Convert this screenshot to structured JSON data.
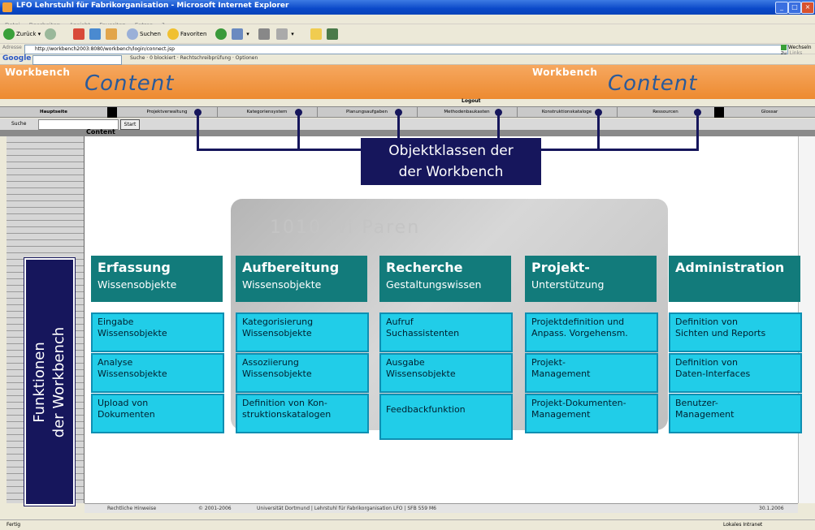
{
  "browser": {
    "title": "LFO Lehrstuhl für Fabrikorganisation - Microsoft Internet Explorer",
    "menu": [
      "Datei",
      "Bearbeiten",
      "Ansicht",
      "Favoriten",
      "Extras",
      "?"
    ],
    "toolbar": {
      "back": "Zurück",
      "search": "Suchen",
      "favorites": "Favoriten"
    },
    "address_label": "Adresse",
    "address_value": "http://workbench2003:8080/workbench/login/connect.jsp",
    "go_label": "Wechseln zu",
    "links_label": "Links",
    "google": {
      "brand": "Google",
      "items": "Suche  ·  0 blockiert  ·  Rechtschreibprüfung  ·  Optionen"
    }
  },
  "site": {
    "brand_left": "Workbench",
    "content_left": "Content",
    "brand_right": "Workbench",
    "content_right": "Content",
    "logout": "Logout",
    "nav": [
      "Hauptseite",
      "Projektverwaltung",
      "Kategoriensystem",
      "Planungsaufgaben",
      "Methodenbaukasten",
      "Konstruktionskataloge",
      "Ressourcen",
      "Glossar"
    ],
    "search_label": "Suche",
    "start_button": "Start",
    "content_label": "Content"
  },
  "overlay": {
    "objektklassen_line1": "Objektklassen der",
    "objektklassen_line2": "der Workbench",
    "funktionen_line1": "Funktionen",
    "funktionen_line2": "der Workbench",
    "watermark": "1010 Wi Paren"
  },
  "columns": [
    {
      "title": "Erfassung",
      "subtitle": "Wissensobjekte",
      "items": [
        [
          "Eingabe",
          "Wissensobjekte"
        ],
        [
          "Analyse",
          "Wissensobjekte"
        ],
        [
          "Upload von",
          "Dokumenten"
        ]
      ]
    },
    {
      "title": "Aufbereitung",
      "subtitle": "Wissensobjekte",
      "items": [
        [
          "Kategorisierung",
          "Wissensobjekte"
        ],
        [
          "Assoziierung",
          "Wissensobjekte"
        ],
        [
          "Definition von Kon-",
          "struktionskatalogen"
        ]
      ]
    },
    {
      "title": "Recherche",
      "subtitle": "Gestaltungswissen",
      "items": [
        [
          "Aufruf",
          "Suchassistenten"
        ],
        [
          "Ausgabe",
          "Wissensobjekte"
        ],
        [
          "Feedbackfunktion",
          ""
        ]
      ]
    },
    {
      "title": "Projekt-",
      "subtitle": "Unterstützung",
      "items": [
        [
          "Projektdefinition und",
          "Anpass. Vorgehensm."
        ],
        [
          "Projekt-",
          "Management"
        ],
        [
          "Projekt-Dokumenten-",
          "Management"
        ]
      ]
    },
    {
      "title": "Administration",
      "subtitle": "",
      "items": [
        [
          "Definition von",
          "Sichten und Reports"
        ],
        [
          "Definition von",
          "Daten-Interfaces"
        ],
        [
          "Benutzer-",
          "Management"
        ]
      ]
    }
  ],
  "footer": {
    "legal": "Rechtliche Hinweise",
    "copyright": "© 2001-2006",
    "university": "Universität Dortmund | Lehrstuhl für Fabrikorganisation LFO | SFB 559 M6",
    "date": "30.1.2006"
  },
  "status": {
    "left": "Fertig",
    "right": "Lokales Intranet"
  }
}
